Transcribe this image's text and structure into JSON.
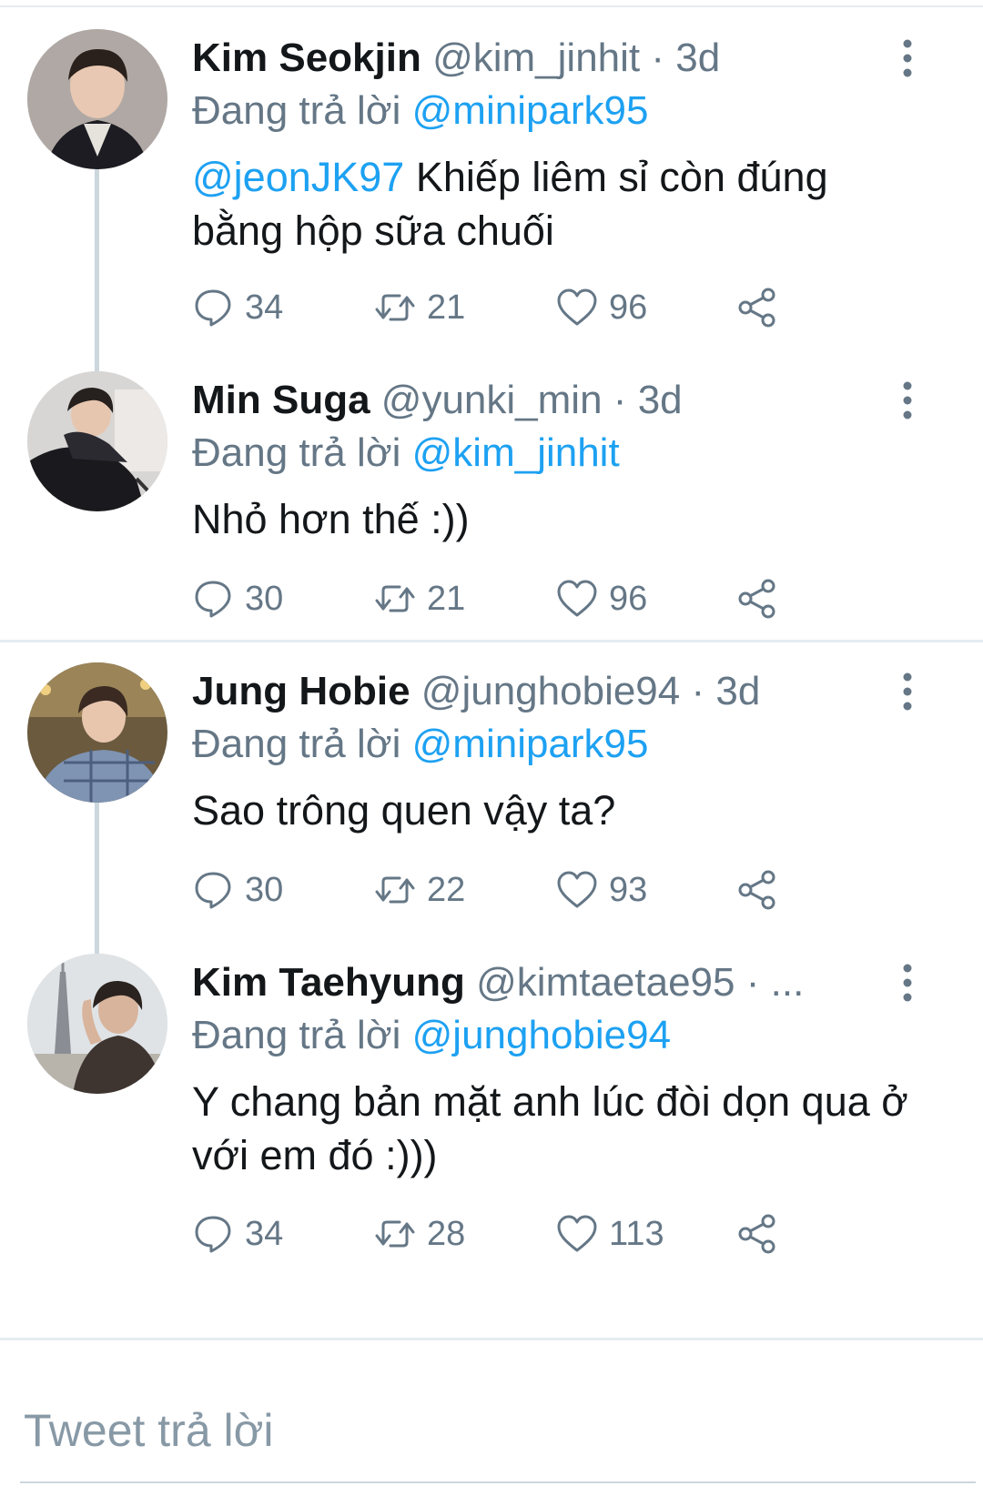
{
  "tweets": [
    {
      "name": "Kim Seokjin",
      "handle": "@kim_jinhit",
      "dot": "·",
      "time": "3d",
      "reply_prefix": "Đang trả lời",
      "reply_to": "@minipark95",
      "mention": "@jeonJK97",
      "text": " Khiếp liêm sỉ còn đúng bằng hộp sữa chuối",
      "replies": "34",
      "retweets": "21",
      "likes": "96"
    },
    {
      "name": "Min Suga",
      "handle": "@yunki_min",
      "dot": "·",
      "time": "3d",
      "reply_prefix": "Đang trả lời",
      "reply_to": "@kim_jinhit",
      "text": "Nhỏ hơn thế :))",
      "replies": "30",
      "retweets": "21",
      "likes": "96"
    },
    {
      "name": "Jung Hobie",
      "handle": "@junghobie94",
      "dot": "·",
      "time": "3d",
      "reply_prefix": "Đang trả lời",
      "reply_to": "@minipark95",
      "text": "Sao trông quen vậy ta?",
      "replies": "30",
      "retweets": "22",
      "likes": "93"
    },
    {
      "name": "Kim Taehyung",
      "handle": "@kimtaetae95",
      "dot": "·",
      "time": "...",
      "reply_prefix": "Đang trả lời",
      "reply_to": "@junghobie94",
      "text": "Y chang bản mặt anh lúc đòi dọn qua ở với em đó :)))",
      "replies": "34",
      "retweets": "28",
      "likes": "113"
    }
  ],
  "compose": {
    "placeholder": "Tweet trả lời"
  },
  "icons": {
    "reply": "reply-icon",
    "retweet": "retweet-icon",
    "like": "heart-icon",
    "share": "share-icon",
    "more": "more-vertical-icon"
  },
  "colors": {
    "link": "#1da1f2",
    "secondary_text": "#657786",
    "primary_text": "#14171a",
    "divider": "#e6ecf0"
  }
}
